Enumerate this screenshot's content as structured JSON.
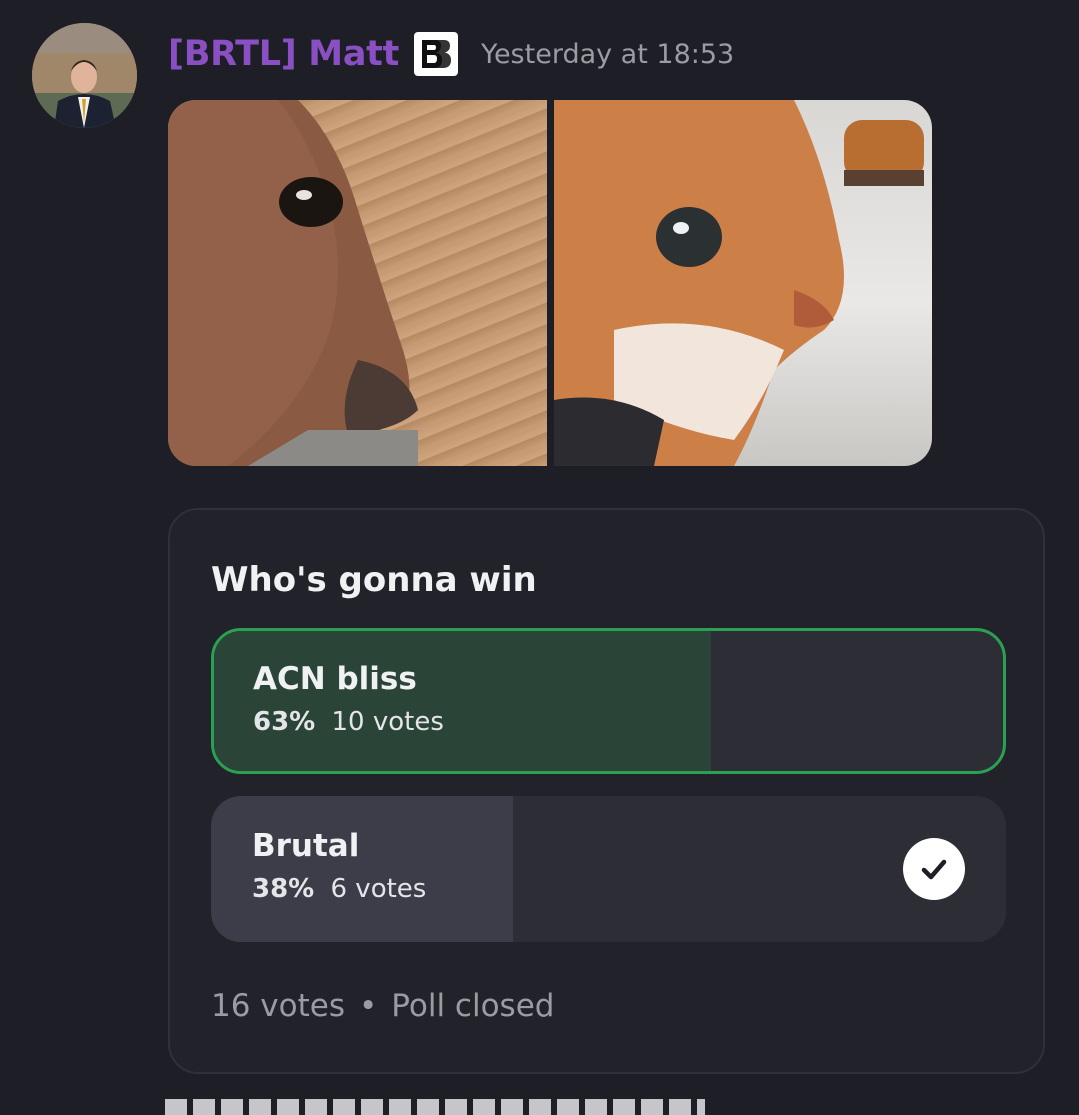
{
  "message": {
    "author": "[BRTL] Matt",
    "timestamp": "Yesterday at 18:53",
    "colors": {
      "username": "#8b4fc4",
      "background": "#1e1f26"
    },
    "icons": {
      "avatar": "avatar-photo",
      "badge": "brtl-badge-icon"
    }
  },
  "poll": {
    "question": "Who's gonna win",
    "answers": [
      {
        "label": "ACN bliss",
        "percent": "63%",
        "votes": "10 votes",
        "fill_fraction": 0.63,
        "winner": true,
        "voted": false
      },
      {
        "label": "Brutal",
        "percent": "38%",
        "votes": "6 votes",
        "fill_fraction": 0.38,
        "winner": false,
        "voted": true
      }
    ],
    "total_votes": "16 votes",
    "separator": "•",
    "status": "Poll closed",
    "colors": {
      "winner_border": "#2aa152",
      "winner_fill": "#2a4438",
      "fill": "#3c3d48"
    }
  }
}
